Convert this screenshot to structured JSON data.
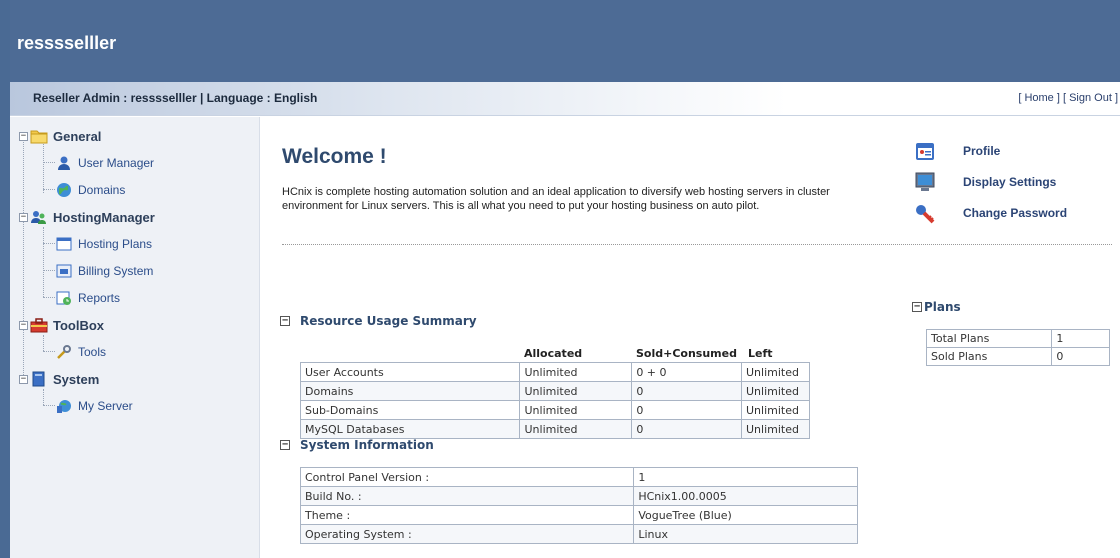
{
  "header": {
    "title": "resssselller"
  },
  "subbar": {
    "info": "Reseller Admin : resssselller | Language : English",
    "home_link": "[ Home ]",
    "signout_link": "[ Sign Out ]"
  },
  "sidebar": {
    "general": {
      "label": "General",
      "items": [
        {
          "label": "User Manager",
          "icon": "user-icon"
        },
        {
          "label": "Domains",
          "icon": "globe-icon"
        }
      ]
    },
    "hosting": {
      "label": "HostingManager",
      "items": [
        {
          "label": "Hosting Plans",
          "icon": "window-icon"
        },
        {
          "label": "Billing System",
          "icon": "calculator-icon"
        },
        {
          "label": "Reports",
          "icon": "report-icon"
        }
      ]
    },
    "toolbox": {
      "label": "ToolBox",
      "items": [
        {
          "label": "Tools",
          "icon": "wrench-icon"
        }
      ]
    },
    "system": {
      "label": "System",
      "items": [
        {
          "label": "My Server",
          "icon": "server-icon"
        }
      ]
    }
  },
  "main": {
    "welcome": "Welcome !",
    "description": "HCnix is complete hosting automation solution and an ideal application to diversify web hosting servers in cluster environment for Linux servers. This is all what you need to put your hosting business on auto pilot."
  },
  "quick_links": [
    {
      "label": "Profile",
      "icon": "profile-card-icon"
    },
    {
      "label": "Display Settings",
      "icon": "monitor-icon"
    },
    {
      "label": "Change Password",
      "icon": "key-icon"
    }
  ],
  "resource": {
    "title": "Resource Usage Summary",
    "columns": [
      "Allocated",
      "Sold+Consumed",
      "Left"
    ],
    "rows": [
      {
        "name": "User Accounts",
        "allocated": "Unlimited",
        "sold": "0 + 0",
        "left": "Unlimited"
      },
      {
        "name": "Domains",
        "allocated": "Unlimited",
        "sold": "0",
        "left": "Unlimited"
      },
      {
        "name": "Sub-Domains",
        "allocated": "Unlimited",
        "sold": "0",
        "left": "Unlimited"
      },
      {
        "name": "MySQL Databases",
        "allocated": "Unlimited",
        "sold": "0",
        "left": "Unlimited"
      }
    ]
  },
  "system_info": {
    "title": "System Information",
    "rows": [
      {
        "name": "Control Panel Version :",
        "value": "1"
      },
      {
        "name": "Build No. :",
        "value": "HCnix1.00.0005"
      },
      {
        "name": "Theme :",
        "value": "VogueTree (Blue)"
      },
      {
        "name": "Operating System :",
        "value": "Linux"
      }
    ]
  },
  "plans": {
    "title": "Plans",
    "rows": [
      {
        "name": "Total Plans",
        "value": "1"
      },
      {
        "name": "Sold Plans",
        "value": "0"
      }
    ]
  }
}
